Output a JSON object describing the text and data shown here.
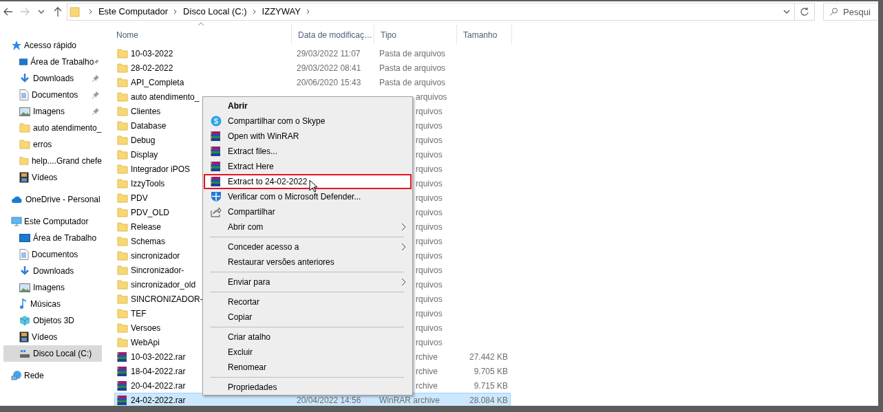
{
  "nav": [
    {
      "kind": "back",
      "disabled": false
    },
    {
      "kind": "forward",
      "disabled": true
    },
    {
      "kind": "recent",
      "disabled": false
    },
    {
      "kind": "up",
      "disabled": false
    }
  ],
  "address": {
    "crumbs": [
      "Este Computador",
      "Disco Local (C:)",
      "IZZYWAY"
    ]
  },
  "search": {
    "placeholder": "Pesqui"
  },
  "sidebar": {
    "sections": [
      {
        "label": "Acesso rápido",
        "kind": "star",
        "items": [
          {
            "label": "Área de Trabalho",
            "kind": "desktop",
            "pinned": true,
            "selected": false
          },
          {
            "label": "Downloads",
            "kind": "downloads",
            "pinned": true,
            "selected": false
          },
          {
            "label": "Documentos",
            "kind": "documents",
            "pinned": true,
            "selected": false
          },
          {
            "label": "Imagens",
            "kind": "images",
            "pinned": true,
            "selected": false
          },
          {
            "label": "auto atendimento_",
            "kind": "folder",
            "pinned": false,
            "selected": false
          },
          {
            "label": "erros",
            "kind": "folder",
            "pinned": false,
            "selected": false
          },
          {
            "label": "help....Grand chefe",
            "kind": "folder",
            "pinned": false,
            "selected": false
          },
          {
            "label": "Vídeos",
            "kind": "videos",
            "pinned": false,
            "selected": false
          }
        ]
      },
      {
        "label": "OneDrive - Personal",
        "kind": "cloud"
      },
      {
        "label": "Este Computador",
        "kind": "computer",
        "items": [
          {
            "label": "Área de Trabalho",
            "kind": "desktop",
            "pinned": false,
            "selected": false
          },
          {
            "label": "Documentos",
            "kind": "documents",
            "pinned": false,
            "selected": false
          },
          {
            "label": "Downloads",
            "kind": "downloads",
            "pinned": false,
            "selected": false
          },
          {
            "label": "Imagens",
            "kind": "images",
            "pinned": false,
            "selected": false
          },
          {
            "label": "Músicas",
            "kind": "music",
            "pinned": false,
            "selected": false
          },
          {
            "label": "Objetos 3D",
            "kind": "objects3d",
            "pinned": false,
            "selected": false
          },
          {
            "label": "Vídeos",
            "kind": "videos",
            "pinned": false,
            "selected": false
          },
          {
            "label": "Disco Local (C:)",
            "kind": "drive",
            "pinned": false,
            "selected": true
          }
        ]
      },
      {
        "label": "Rede",
        "kind": "network"
      }
    ]
  },
  "table": {
    "columns": [
      {
        "label": "Nome",
        "sorted": true
      },
      {
        "label": "Data de modificaç…",
        "sorted": false
      },
      {
        "label": "Tipo",
        "sorted": false
      },
      {
        "label": "Tamanho",
        "sorted": false
      }
    ],
    "rows": [
      {
        "name": "10-03-2022",
        "kind": "folder",
        "date": "29/03/2022 11:07",
        "type": "Pasta de arquivos",
        "covered": false,
        "selected": false
      },
      {
        "name": "28-02-2022",
        "kind": "folder",
        "date": "29/03/2022 08:41",
        "type": "Pasta de arquivos",
        "covered": false,
        "selected": false
      },
      {
        "name": "API_Completa",
        "kind": "folder",
        "date": "20/06/2020 15:43",
        "type": "Pasta de arquivos",
        "covered": false,
        "selected": false
      },
      {
        "name": "auto atendimento_",
        "kind": "folder",
        "type": "arquivos",
        "covered": true,
        "selected": false
      },
      {
        "name": "Clientes",
        "kind": "folder",
        "type": "rquivos",
        "covered": true,
        "selected": false
      },
      {
        "name": "Database",
        "kind": "folder",
        "type": "rquivos",
        "covered": true,
        "selected": false
      },
      {
        "name": "Debug",
        "kind": "folder",
        "type": "rquivos",
        "covered": true,
        "selected": false
      },
      {
        "name": "Display",
        "kind": "folder",
        "type": "rquivos",
        "covered": true,
        "selected": false
      },
      {
        "name": "Integrador iPOS",
        "kind": "folder",
        "type": "rquivos",
        "covered": true,
        "selected": false
      },
      {
        "name": "IzzyTools",
        "kind": "folder",
        "type": "rquivos",
        "covered": true,
        "selected": false
      },
      {
        "name": "PDV",
        "kind": "folder",
        "type": "rquivos",
        "covered": true,
        "selected": false
      },
      {
        "name": "PDV_OLD",
        "kind": "folder",
        "type": "rquivos",
        "covered": true,
        "selected": false
      },
      {
        "name": "Release",
        "kind": "folder",
        "type": "rquivos",
        "covered": true,
        "selected": false
      },
      {
        "name": "Schemas",
        "kind": "folder",
        "type": "rquivos",
        "covered": true,
        "selected": false
      },
      {
        "name": "sincronizador",
        "kind": "folder",
        "type": "rquivos",
        "covered": true,
        "selected": false
      },
      {
        "name": "Sincronizador-",
        "kind": "folder",
        "type": "rquivos",
        "covered": true,
        "selected": false
      },
      {
        "name": "sincronizador_old",
        "kind": "folder",
        "type": "rquivos",
        "covered": true,
        "selected": false
      },
      {
        "name": "SINCRONIZADOR-",
        "kind": "folder",
        "type": "rquivos",
        "covered": true,
        "selected": false
      },
      {
        "name": "TEF",
        "kind": "folder",
        "type": "rquivos",
        "covered": true,
        "selected": false
      },
      {
        "name": "Versoes",
        "kind": "folder",
        "type": "rquivos",
        "covered": true,
        "selected": false
      },
      {
        "name": "WebApi",
        "kind": "folder",
        "type": "rquivos",
        "covered": true,
        "selected": false
      },
      {
        "name": "10-03-2022.rar",
        "kind": "rar",
        "type": "rchive",
        "size": "27.442 KB",
        "covered": true,
        "selected": false
      },
      {
        "name": "18-04-2022.rar",
        "kind": "rar",
        "type": "rchive",
        "size": "9.705 KB",
        "covered": true,
        "selected": false
      },
      {
        "name": "20-04-2022.rar",
        "kind": "rar",
        "type": "rchive",
        "size": "9.715 KB",
        "covered": true,
        "selected": false
      },
      {
        "name": "24-02-2022.rar",
        "kind": "rar",
        "date": "20/04/2022 14:56",
        "type": "WinRAR archive",
        "size": "28.084 KB",
        "covered": false,
        "selected": true
      }
    ]
  },
  "context_menu": {
    "groups": [
      [
        {
          "label": "Abrir",
          "kind": "plain",
          "default": true,
          "submenu": false,
          "selected": false
        },
        {
          "label": "Compartilhar com o Skype",
          "kind": "skype",
          "default": false,
          "submenu": false,
          "selected": false
        },
        {
          "label": "Open with WinRAR",
          "kind": "winrar",
          "default": false,
          "submenu": false,
          "selected": false
        },
        {
          "label": "Extract files...",
          "kind": "winrar",
          "default": false,
          "submenu": false,
          "selected": false
        },
        {
          "label": "Extract Here",
          "kind": "winrar",
          "default": false,
          "submenu": false,
          "selected": false
        },
        {
          "label": "Extract to 24-02-2022",
          "kind": "winrar",
          "default": false,
          "submenu": false,
          "selected": true
        },
        {
          "label": "Verificar com o Microsoft Defender...",
          "kind": "defender",
          "default": false,
          "submenu": false,
          "selected": false
        },
        {
          "label": "Compartilhar",
          "kind": "share",
          "default": false,
          "submenu": false,
          "selected": false
        },
        {
          "label": "Abrir com",
          "kind": "plain",
          "default": false,
          "submenu": true,
          "selected": false
        }
      ],
      [
        {
          "label": "Conceder acesso a",
          "kind": "plain",
          "default": false,
          "submenu": true,
          "selected": false
        },
        {
          "label": "Restaurar versões anteriores",
          "kind": "plain",
          "default": false,
          "submenu": false,
          "selected": false
        }
      ],
      [
        {
          "label": "Enviar para",
          "kind": "plain",
          "default": false,
          "submenu": true,
          "selected": false
        }
      ],
      [
        {
          "label": "Recortar",
          "kind": "plain",
          "default": false,
          "submenu": false,
          "selected": false
        },
        {
          "label": "Copiar",
          "kind": "plain",
          "default": false,
          "submenu": false,
          "selected": false
        }
      ],
      [
        {
          "label": "Criar atalho",
          "kind": "plain",
          "default": false,
          "submenu": false,
          "selected": false
        },
        {
          "label": "Excluir",
          "kind": "plain",
          "default": false,
          "submenu": false,
          "selected": false
        },
        {
          "label": "Renomear",
          "kind": "plain",
          "default": false,
          "submenu": false,
          "selected": false
        }
      ],
      [
        {
          "label": "Propriedades",
          "kind": "plain",
          "default": false,
          "submenu": false,
          "selected": false
        }
      ]
    ]
  }
}
